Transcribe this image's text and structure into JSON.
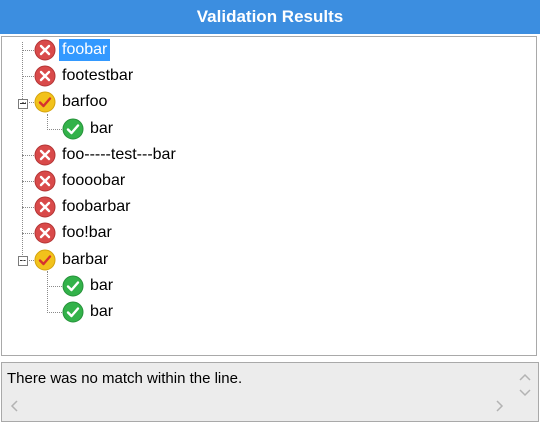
{
  "header": {
    "title": "Validation Results"
  },
  "tree": {
    "items": [
      {
        "label": "foobar",
        "status": "error",
        "level": 0,
        "selected": true
      },
      {
        "label": "footestbar",
        "status": "error",
        "level": 0
      },
      {
        "label": "barfoo",
        "status": "partial",
        "level": 0,
        "expanded": true
      },
      {
        "label": "bar",
        "status": "ok",
        "level": 1
      },
      {
        "label": "foo-----test---bar",
        "status": "error",
        "level": 0
      },
      {
        "label": "foooobar",
        "status": "error",
        "level": 0
      },
      {
        "label": "foobarbar",
        "status": "error",
        "level": 0
      },
      {
        "label": "foo!bar",
        "status": "error",
        "level": 0
      },
      {
        "label": "barbar",
        "status": "partial",
        "level": 0,
        "expanded": true
      },
      {
        "label": "bar",
        "status": "ok",
        "level": 1
      },
      {
        "label": "bar",
        "status": "ok",
        "level": 1
      }
    ]
  },
  "status": {
    "message": "There was no match within the line."
  },
  "icons": {
    "error": "error-x-icon",
    "partial": "partial-check-icon",
    "ok": "success-check-icon",
    "up": "chevron-up-icon",
    "down": "chevron-down-icon",
    "left": "chevron-left-icon",
    "right": "chevron-right-icon"
  },
  "colors": {
    "header_bg": "#3c8ee0",
    "selection": "#3399ff",
    "error": "#d94a4a",
    "ok": "#33b24a",
    "partial": "#f2c21b"
  }
}
